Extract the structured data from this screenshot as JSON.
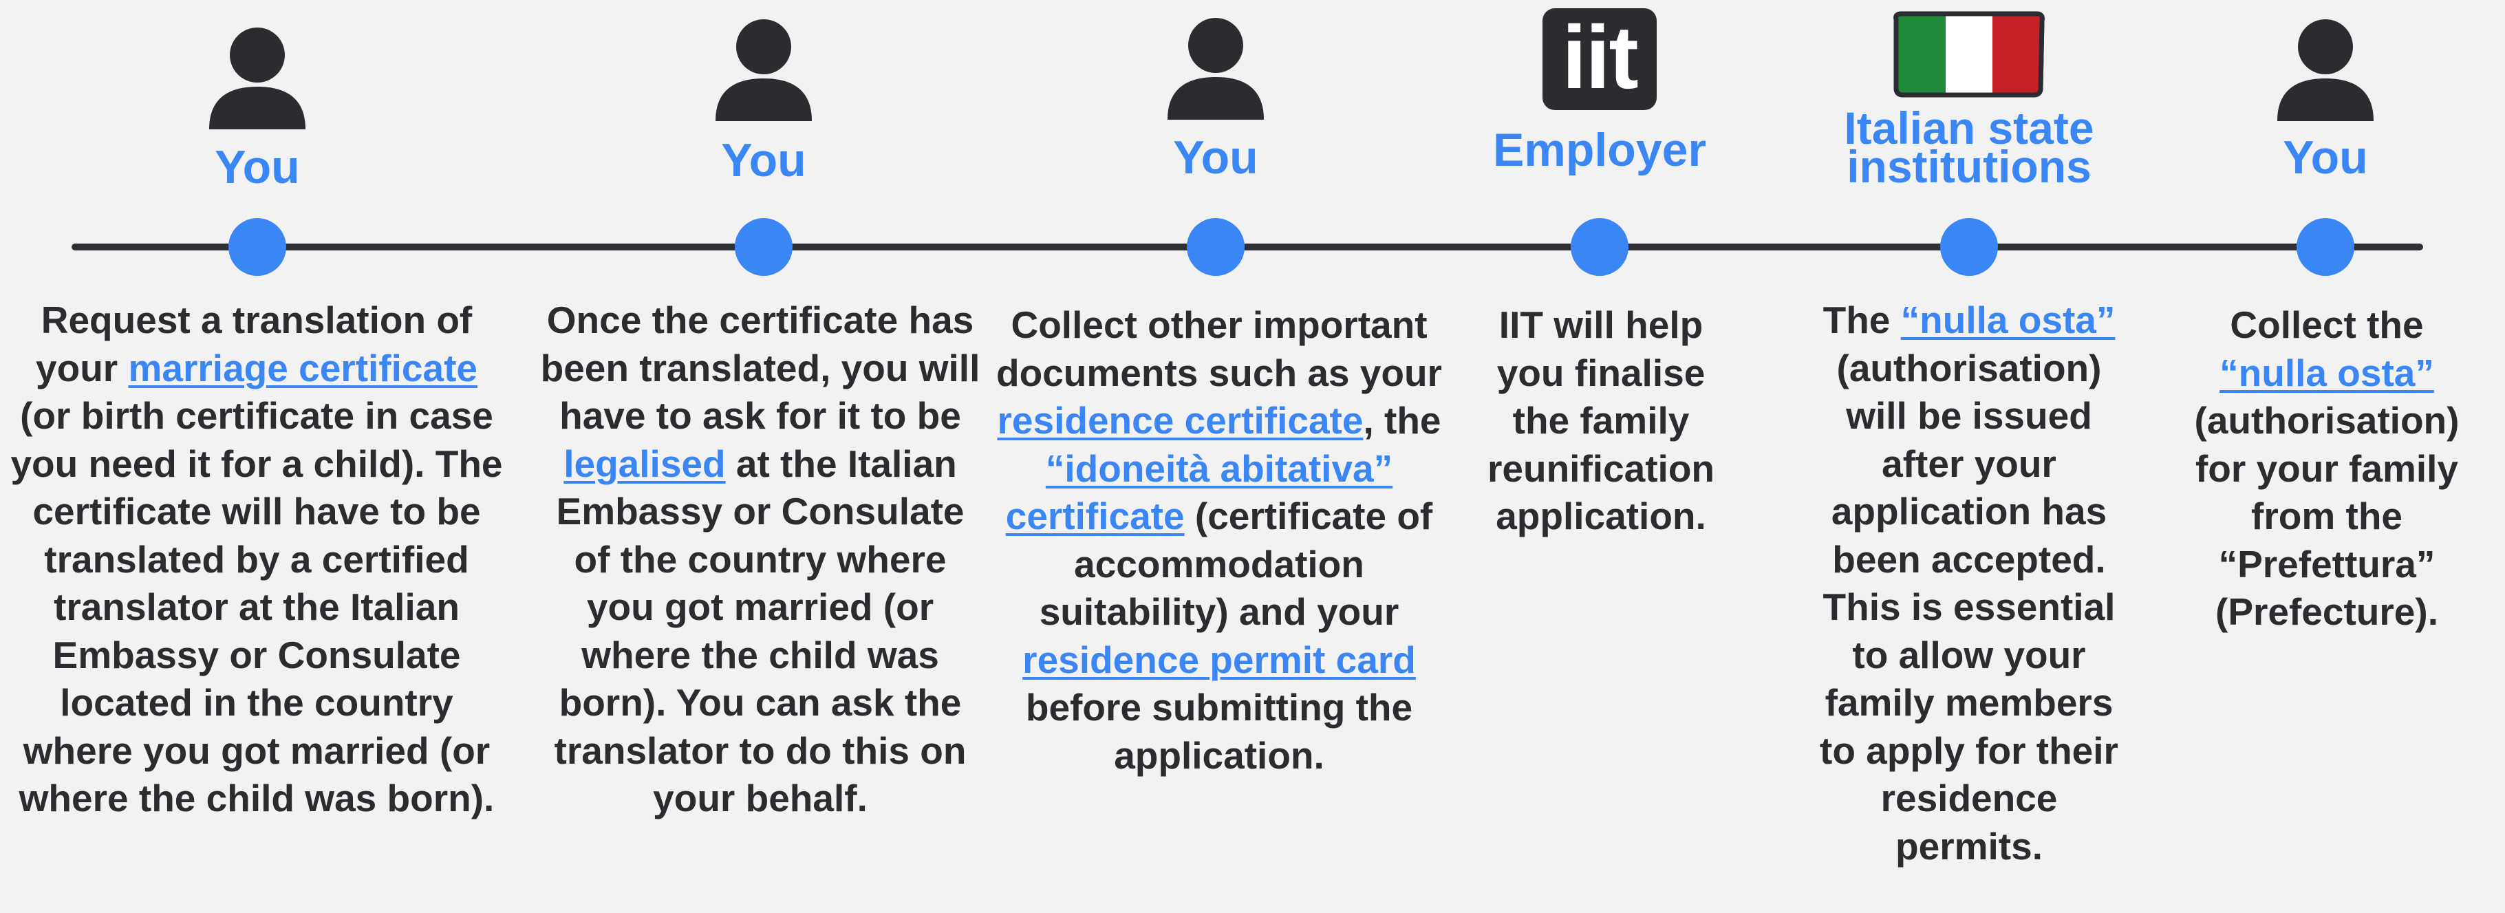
{
  "steps": [
    {
      "actor": "You",
      "icon": "person-icon",
      "parts": [
        {
          "t": "Request a translation of your "
        },
        {
          "t": "marriage certificate",
          "link": true
        },
        {
          "t": " (or birth certificate in case you need it for a child). The certificate will have to be translated by a certified translator at the Italian Embassy or Consulate located in the country where you got married (or where the child was born)."
        }
      ]
    },
    {
      "actor": "You",
      "icon": "person-icon",
      "parts": [
        {
          "t": "Once the certificate has been translated, you will have to ask for it to be "
        },
        {
          "t": "legalised",
          "link": true
        },
        {
          "t": " at the Italian Embassy or Consulate of the country where you got married (or where the child was born). You can ask the translator to do this on your behalf."
        }
      ]
    },
    {
      "actor": "You",
      "icon": "person-icon",
      "parts": [
        {
          "t": "Collect other important documents such as your "
        },
        {
          "t": "residence certificate",
          "link": true
        },
        {
          "t": ", the "
        },
        {
          "t": "“idoneità abitativa” certificate",
          "link": true
        },
        {
          "t": " (certificate of accommodation suitability) and your "
        },
        {
          "t": "residence permit card",
          "link": true
        },
        {
          "t": " before submitting the application."
        }
      ]
    },
    {
      "actor": "Employer",
      "icon": "iit-logo-icon",
      "logo_text": "iit",
      "parts": [
        {
          "t": "IIT will help you finalise the family reunification application."
        }
      ]
    },
    {
      "actor": "Italian state institutions",
      "icon": "italian-flag-icon",
      "parts": [
        {
          "t": "The "
        },
        {
          "t": "“nulla osta”",
          "link": true
        },
        {
          "t": " (authorisation) will be issued after your application has been accepted. This is essential to allow your family members to apply for their residence permits."
        }
      ]
    },
    {
      "actor": "You",
      "icon": "person-icon",
      "parts": [
        {
          "t": "Collect the "
        },
        {
          "t": "“nulla osta”",
          "link": true
        },
        {
          "t": " (authorisation) for your family from the “Prefettura” (Prefecture)."
        }
      ]
    }
  ],
  "colors": {
    "accent": "#3b86f5",
    "text": "#2b2c30",
    "line": "#2e2f33",
    "flag_green": "#1f8a3a",
    "flag_white": "#ffffff",
    "flag_red": "#c62128"
  }
}
